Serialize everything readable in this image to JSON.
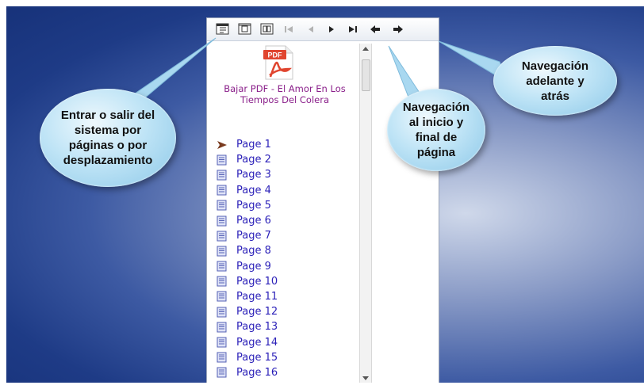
{
  "toolbar": {
    "buttons": [
      {
        "name": "view-mode-icon",
        "glyph": "▤",
        "enabled": true
      },
      {
        "name": "single-page-icon",
        "glyph": "▣",
        "enabled": true
      },
      {
        "name": "double-page-icon",
        "glyph": "▣",
        "enabled": true
      },
      {
        "name": "first-page-icon",
        "glyph": "|◀",
        "enabled": false
      },
      {
        "name": "previous-page-icon",
        "glyph": "◀",
        "enabled": false
      },
      {
        "name": "next-page-icon",
        "glyph": "▶",
        "enabled": true
      },
      {
        "name": "last-page-icon",
        "glyph": "▶|",
        "enabled": true
      },
      {
        "name": "back-icon",
        "glyph": "⬅",
        "enabled": true
      },
      {
        "name": "forward-icon",
        "glyph": "➡",
        "enabled": true
      }
    ]
  },
  "sidebar": {
    "pdf_icon_label": "PDF",
    "download_link": "Bajar PDF - El Amor En Los Tiempos Del Colera",
    "pages": [
      "Page 1",
      "Page 2",
      "Page 3",
      "Page 4",
      "Page 5",
      "Page 6",
      "Page 7",
      "Page 8",
      "Page 9",
      "Page 10",
      "Page 11",
      "Page 12",
      "Page 13",
      "Page 14",
      "Page 15",
      "Page 16"
    ]
  },
  "callouts": {
    "view_mode": [
      "Entrar o salir del",
      "sistema por",
      "páginas o por",
      "desplazamiento"
    ],
    "start_end": [
      "Navegación",
      "al inicio  y",
      "final de",
      "página"
    ],
    "back_forward": [
      "Navegación",
      "adelante y",
      "atrás"
    ]
  },
  "colors": {
    "link": "#8a1f8a",
    "page_text": "#2a1fb8",
    "bubble": "#bfe4f6"
  }
}
